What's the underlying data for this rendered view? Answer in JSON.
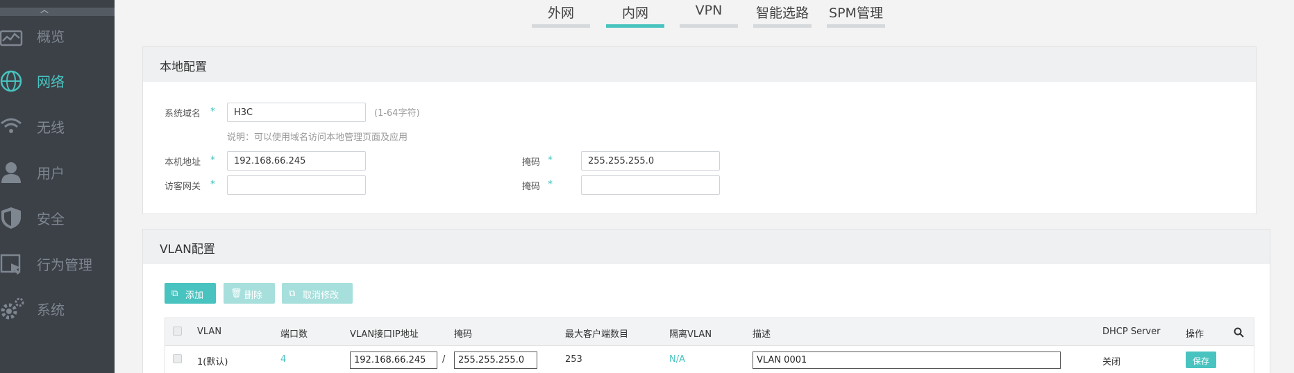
{
  "sidebar": {
    "items": [
      {
        "label": "概览"
      },
      {
        "label": "网络"
      },
      {
        "label": "无线"
      },
      {
        "label": "用户"
      },
      {
        "label": "安全"
      },
      {
        "label": "行为管理"
      },
      {
        "label": "系统"
      }
    ],
    "active_index": 1
  },
  "tabs": [
    {
      "label": "外网"
    },
    {
      "label": "内网"
    },
    {
      "label": "VPN"
    },
    {
      "label": "智能选路"
    },
    {
      "label": "SPM管理"
    }
  ],
  "active_tab": 1,
  "local_config": {
    "title": "本地配置",
    "domain_label": "系统域名",
    "domain_value": "H3C",
    "domain_hint": "(1-64字符)",
    "domain_note": "说明：可以使用域名访问本地管理页面及应用",
    "ip_label": "本机地址",
    "ip_value": "192.168.66.245",
    "mask_label": "掩码",
    "mask_value": "255.255.255.0",
    "guest_label": "访客网关",
    "guest_value": "",
    "guest_mask_label": "掩码",
    "guest_mask_value": "",
    "required_mark": "*"
  },
  "vlan_config": {
    "title": "VLAN配置",
    "buttons": {
      "add": "添加",
      "delete": "删除",
      "cancel": "取消修改"
    },
    "columns": [
      "VLAN",
      "端口数",
      "VLAN接口IP地址",
      "掩码",
      "最大客户端数目",
      "隔离VLAN",
      "描述",
      "DHCP Server",
      "操作"
    ],
    "rows": [
      {
        "vlan": "1(默认)",
        "ports": "4",
        "ip": "192.168.66.245",
        "sep": "/",
        "mask": "255.255.255.0",
        "max_clients": "253",
        "isolate": "N/A",
        "desc": "VLAN 0001",
        "dhcp": "关闭",
        "action": "保存"
      }
    ]
  },
  "colors": {
    "accent": "#48c3bf",
    "sidebar_bg": "#3c4148"
  }
}
